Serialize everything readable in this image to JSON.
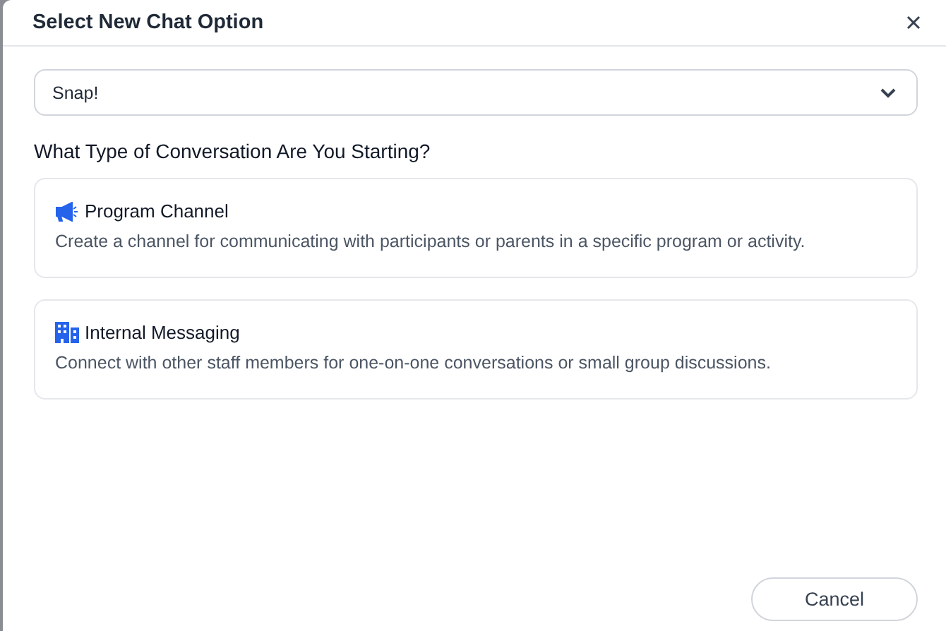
{
  "dialog": {
    "title": "Select New Chat Option"
  },
  "select": {
    "value": "Snap!"
  },
  "heading": "What Type of Conversation Are You Starting?",
  "options": [
    {
      "kind": "megaphone",
      "title": "Program Channel",
      "description": "Create a channel for communicating with participants or parents in a specific program or activity."
    },
    {
      "kind": "building",
      "title": "Internal Messaging",
      "description": "Connect with other staff members for one-on-one conversations or small group discussions."
    }
  ],
  "buttons": [
    "Cancel"
  ]
}
